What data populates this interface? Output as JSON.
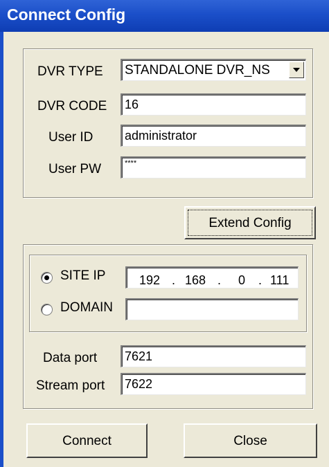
{
  "window": {
    "title": "Connect Config"
  },
  "login": {
    "dvr_type_label": "DVR TYPE",
    "dvr_type_value": "STANDALONE DVR_NS",
    "dvr_code_label": "DVR CODE",
    "dvr_code_value": "16",
    "user_id_label": "User ID",
    "user_id_value": "administrator",
    "user_pw_label": "User PW",
    "user_pw_value": "****"
  },
  "extend_config_label": "Extend Config",
  "network": {
    "site_ip_label": "SITE IP",
    "site_ip_selected": true,
    "ip": [
      "192",
      "168",
      "0",
      "111"
    ],
    "ip_dot": ".",
    "domain_label": "DOMAIN",
    "domain_value": "",
    "data_port_label": "Data port",
    "data_port_value": "7621",
    "stream_port_label": "Stream port",
    "stream_port_value": "7622"
  },
  "buttons": {
    "connect": "Connect",
    "close": "Close"
  }
}
